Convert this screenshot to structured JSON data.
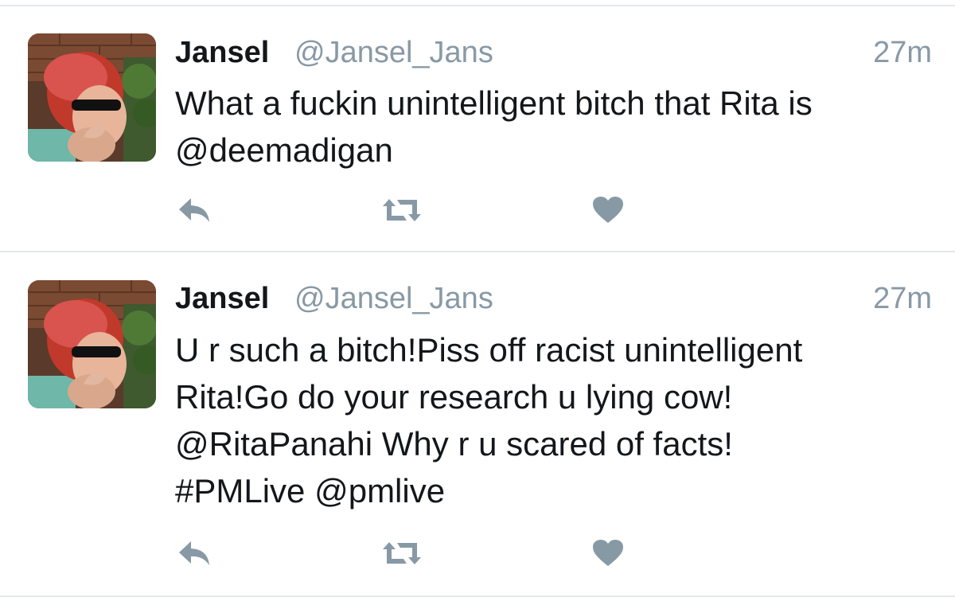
{
  "colors": {
    "name": "#14171a",
    "secondary": "#8899a6",
    "icon": "#8899a6",
    "divider": "#e1e8ed"
  },
  "tweets": [
    {
      "name": "Jansel",
      "handle": "@Jansel_Jans",
      "time": "27m",
      "lines": [
        "What a fuckin unintelligent bitch that Rita is",
        "@deemadigan"
      ],
      "actions": {
        "reply_icon": "reply-icon",
        "retweet_icon": "retweet-icon",
        "like_icon": "heart-icon"
      }
    },
    {
      "name": "Jansel",
      "handle": "@Jansel_Jans",
      "time": "27m",
      "lines": [
        "U r such a bitch!Piss off racist unintelligent",
        "Rita!Go do your research u lying cow!",
        "@RitaPanahi Why r u scared of facts!",
        "#PMLive @pmlive"
      ],
      "actions": {
        "reply_icon": "reply-icon",
        "retweet_icon": "retweet-icon",
        "like_icon": "heart-icon"
      }
    }
  ]
}
